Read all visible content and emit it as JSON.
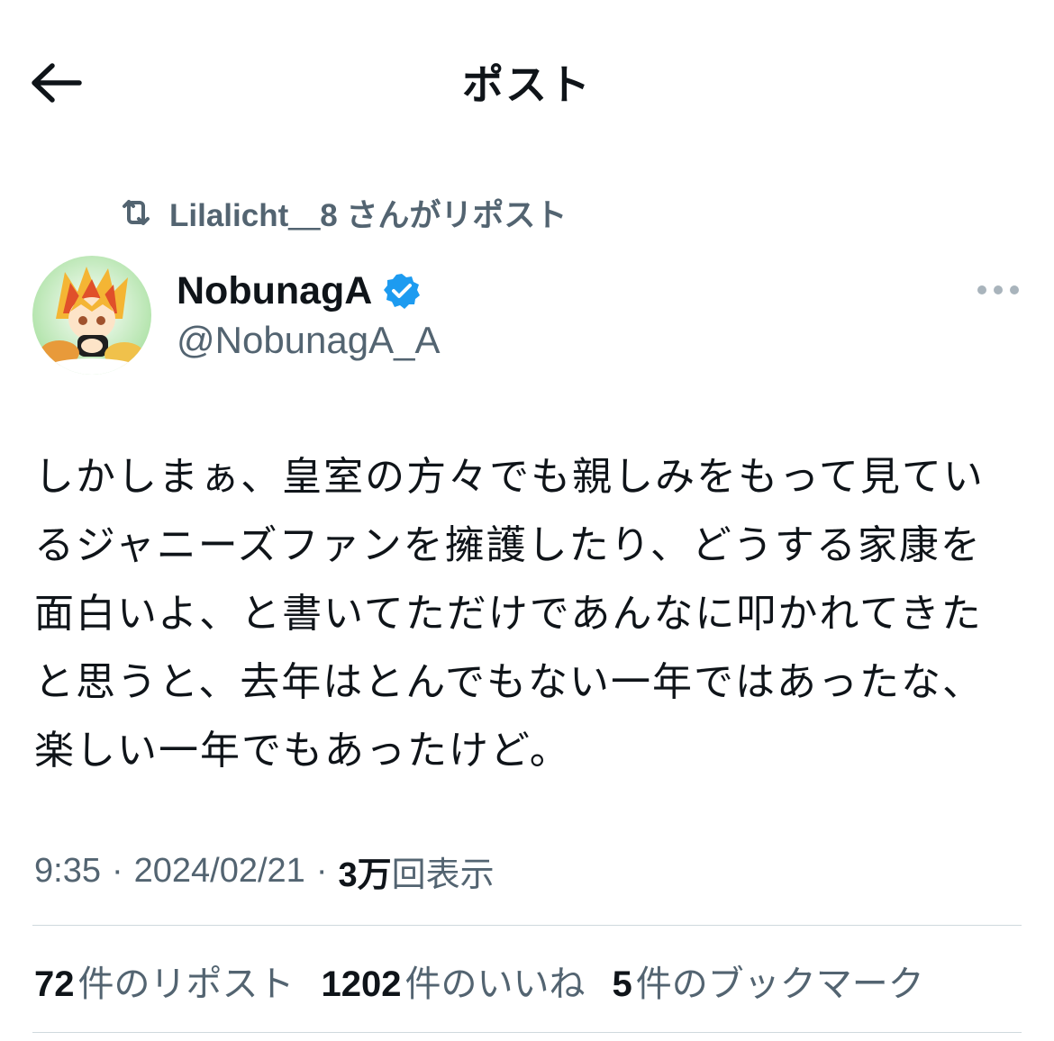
{
  "header": {
    "title": "ポスト"
  },
  "repost": {
    "text": "Lilalicht＿8 さんがリポスト"
  },
  "author": {
    "display_name": "NobunagA",
    "handle": "@NobunagA_A"
  },
  "tweet": {
    "lines": [
      "しかしまぁ、皇室の方々でも親しみをもって見てい",
      "るジャニーズファンを擁護したり、どうする家康を",
      "面白いよ、と書いてただけであんなに叩かれてきた",
      "と思うと、去年はとんでもない一年ではあったな、",
      "楽しい一年でもあったけど。"
    ]
  },
  "meta": {
    "time": "9:35",
    "sep": "·",
    "date": "2024/02/21",
    "views_count": "3万",
    "views_label": "回表示"
  },
  "stats": {
    "reposts": {
      "count": "72",
      "label": "件のリポスト"
    },
    "likes": {
      "count": "1202",
      "label": "件のいいね"
    },
    "bookmarks": {
      "count": "5",
      "label": "件のブックマーク"
    }
  },
  "colors": {
    "text": "#0f1419",
    "secondary": "#536471",
    "verified": "#1d9bf0",
    "divider": "#cfd9de"
  },
  "icons": {
    "back": "arrow-left-icon",
    "repost": "repost-icon",
    "verified": "verified-badge-icon",
    "more": "more-horizontal-icon"
  }
}
